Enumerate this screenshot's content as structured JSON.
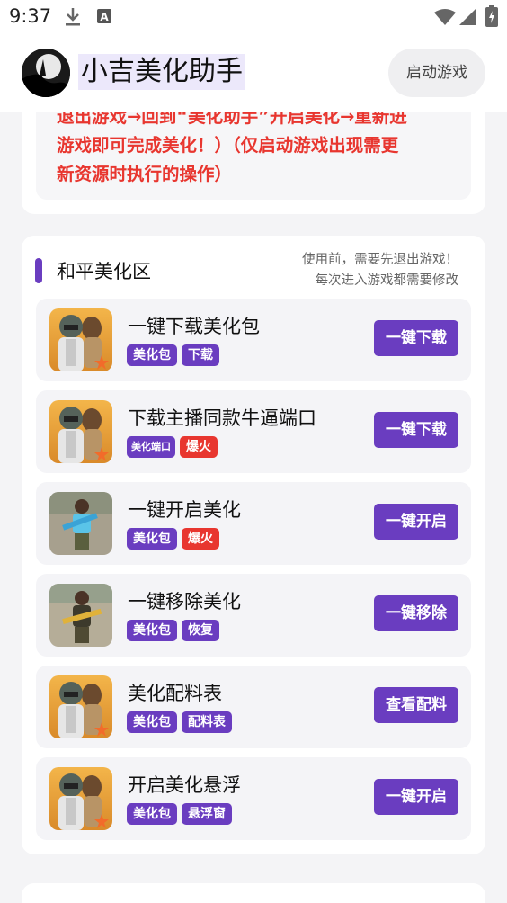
{
  "status": {
    "time": "9:37"
  },
  "header": {
    "title": "小吉美化助手",
    "start_button": "启动游戏"
  },
  "notice": {
    "lines": [
      "退出游戏→回到“美化助手”开启美化→重新进",
      "游戏即可完成美化！）（仅启动游戏出现需更",
      "新资源时执行的操作）"
    ]
  },
  "section": {
    "title": "和平美化区",
    "note_line1": "使用前，需要先退出游戏！",
    "note_line2": "每次进入游戏都需要修改"
  },
  "items": [
    {
      "title": "一键下载美化包",
      "tags": [
        "美化包",
        "下载"
      ],
      "button": "一键下载",
      "thumb": "soldier"
    },
    {
      "title": "下载主播同款牛逼端口",
      "tags": [
        "美化端口",
        "爆火"
      ],
      "button": "一键下载",
      "thumb": "soldier"
    },
    {
      "title": "一键开启美化",
      "tags": [
        "美化包",
        "爆火"
      ],
      "button": "一键开启",
      "thumb": "child-blue"
    },
    {
      "title": "一键移除美化",
      "tags": [
        "美化包",
        "恢复"
      ],
      "button": "一键移除",
      "thumb": "child-gold"
    },
    {
      "title": "美化配料表",
      "tags": [
        "美化包",
        "配料表"
      ],
      "button": "查看配料",
      "thumb": "soldier"
    },
    {
      "title": "开启美化悬浮",
      "tags": [
        "美化包",
        "悬浮窗"
      ],
      "button": "一键开启",
      "thumb": "soldier"
    }
  ],
  "colors": {
    "accent": "#6a3dc0",
    "hot": "#e8362f",
    "notice_text": "#e8362f"
  }
}
